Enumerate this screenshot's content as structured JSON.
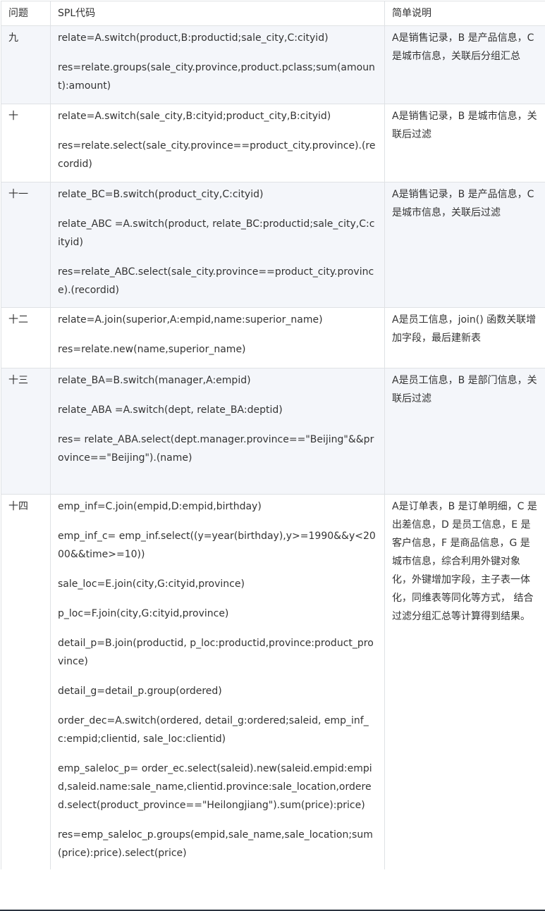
{
  "table": {
    "headers": [
      "问题",
      "SPL代码",
      "简单说明"
    ],
    "rows": [
      {
        "label": "九",
        "code": [
          "relate=A.switch(product,B:productid;sale_city,C:cityid)",
          "res=relate.groups(sale_city.province,product.pclass;sum(amount):amount)"
        ],
        "desc": "A是销售记录，B 是产品信息，C 是城市信息，关联后分组汇总"
      },
      {
        "label": "十",
        "code": [
          "relate=A.switch(sale_city,B:cityid;product_city,B:cityid)",
          "res=relate.select(sale_city.province==product_city.province).(recordid)"
        ],
        "desc": "A是销售记录，B 是城市信息，关联后过滤"
      },
      {
        "label": "十一",
        "code": [
          "relate_BC=B.switch(product_city,C:cityid)",
          "relate_ABC   =A.switch(product, relate_BC:productid;sale_city,C:cityid)",
          "res=relate_ABC.select(sale_city.province==product_city.province).(recordid)"
        ],
        "desc": "A是销售记录，B 是产品信息，C 是城市信息，关联后过滤"
      },
      {
        "label": "十二",
        "code": [
          "relate=A.join(superior,A:empid,name:superior_name)",
          "res=relate.new(name,superior_name)"
        ],
        "desc": "A是员工信息，join() 函数关联增加字段，最后建新表"
      },
      {
        "label": "十三",
        "code": [
          "relate_BA=B.switch(manager,A:empid)",
          "relate_ABA   =A.switch(dept, relate_BA:deptid)",
          "res= relate_ABA.select(dept.manager.province==\"Beijing\"&&province==\"Beijing\").(name)"
        ],
        "desc": "A是员工信息，B 是部门信息，关联后过滤"
      },
      {
        "label": "十四",
        "code": [
          "emp_inf=C.join(empid,D:empid,birthday)",
          "emp_inf_c= emp_inf.select((y=year(birthday),y>=1990&&y<2000&&time>=10))",
          "sale_loc=E.join(city,G:cityid,province)",
          "p_loc=F.join(city,G:cityid,province)",
          "detail_p=B.join(productid, p_loc:productid,province:product_province)",
          "detail_g=detail_p.group(ordered)",
          "order_dec=A.switch(ordered,   detail_g:ordered;saleid, emp_inf_c:empid;clientid, sale_loc:clientid)",
          "emp_saleloc_p= order_ec.select(saleid).new(saleid.empid:empid,saleid.name:sale_name,clientid.province:sale_location,ordered.select(product_province==\"Heilongjiang\").sum(price):price)",
          "res=emp_saleloc_p.groups(empid,sale_name,sale_location;sum(price):price).select(price)"
        ],
        "desc": "A是订单表，B 是订单明细，C 是出差信息，D 是员工信息，E 是客户信息，F 是商品信息，G 是城市信息，综合利用外键对象化，外键增加字段，主子表一体化，同维表等同化等方式， 结合过滤分组汇总等计算得到结果。"
      }
    ]
  }
}
